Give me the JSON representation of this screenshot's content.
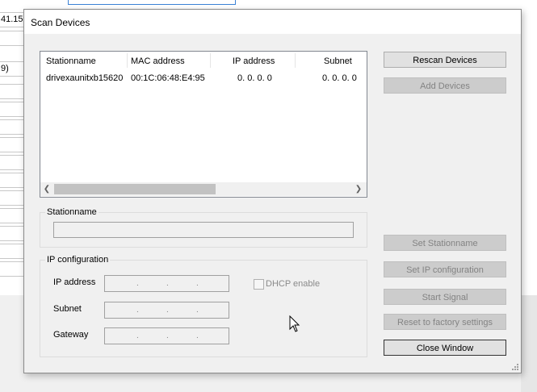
{
  "background": {
    "partial_text_1": "41.15",
    "partial_text_2": "9)"
  },
  "dialog": {
    "title": "Scan Devices"
  },
  "device_list": {
    "columns": [
      "Stationname",
      "MAC address",
      "IP address",
      "Subnet"
    ],
    "rows": [
      {
        "stationname": "drivexaunitxb15620",
        "mac": "00:1C:06:48:E4:95",
        "ip": "0. 0. 0. 0",
        "subnet": "0. 0. 0. 0"
      }
    ],
    "scroll_left_icon": "chevron-left-icon",
    "scroll_right_icon": "chevron-right-icon"
  },
  "stationname_group": {
    "label": "Stationname",
    "value": ""
  },
  "ip_config_group": {
    "label": "IP configuration",
    "ip_label": "IP address",
    "subnet_label": "Subnet",
    "gateway_label": "Gateway",
    "dhcp_label": "DHCP enable",
    "dhcp_checked": false
  },
  "buttons": {
    "rescan": "Rescan Devices",
    "add": "Add Devices",
    "set_stationname": "Set Stationname",
    "set_ip": "Set IP configuration",
    "start_signal": "Start Signal",
    "reset_factory": "Reset to factory settings",
    "close": "Close Window"
  },
  "colors": {
    "dialog_bg": "#f0f0f0",
    "disabled_button": "#cccccc",
    "disabled_text": "#838383"
  }
}
